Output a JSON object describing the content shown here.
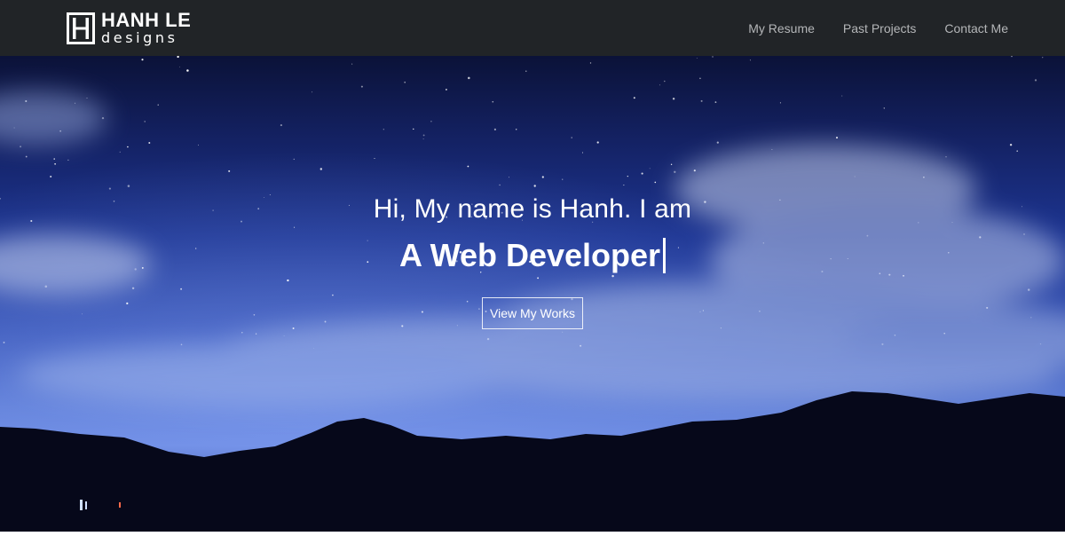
{
  "brand": {
    "name": "HANH LE",
    "sub": "designs",
    "logo_icon": "monogram-h-icon"
  },
  "nav": {
    "items": [
      {
        "label": "My Resume"
      },
      {
        "label": "Past Projects"
      },
      {
        "label": "Contact Me"
      }
    ]
  },
  "hero": {
    "intro": "Hi, My name is Hanh. I am",
    "role": "A Web Developer",
    "button_label": "View My Works"
  },
  "colors": {
    "navbar_bg": "#212427",
    "nav_link": "#b4b6b8",
    "hero_text": "#ffffff",
    "sky_deep": "#142264",
    "sky_horizon": "#6b8ae2",
    "hills": "#06081a"
  }
}
